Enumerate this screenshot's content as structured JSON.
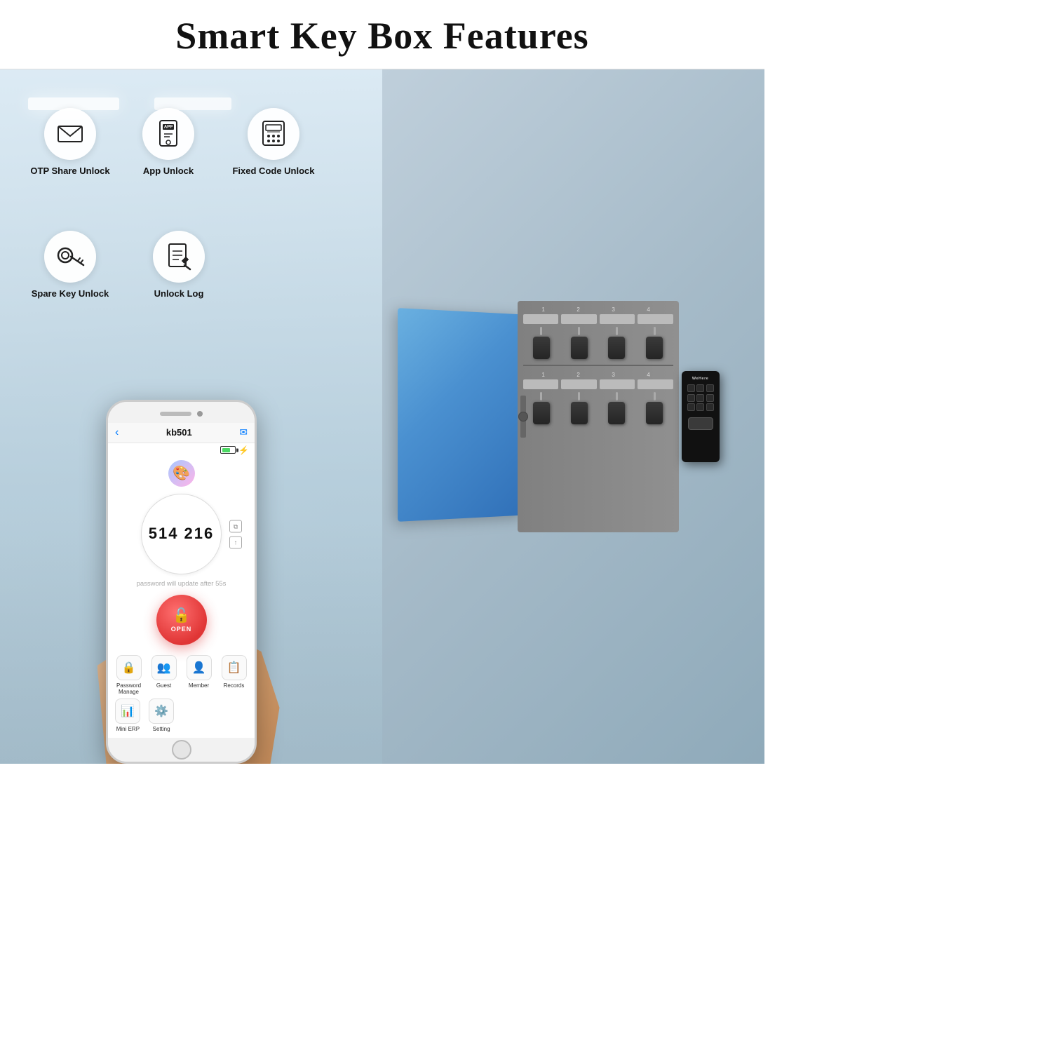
{
  "header": {
    "title": "Smart Key Box Features"
  },
  "features": {
    "top_row": [
      {
        "id": "otp-share-unlock",
        "label": "OTP Share Unlock",
        "icon": "envelope"
      },
      {
        "id": "app-unlock",
        "label": "App Unlock",
        "icon": "app"
      },
      {
        "id": "fixed-code-unlock",
        "label": "Fixed Code Unlock",
        "icon": "keypad"
      }
    ],
    "bottom_row": [
      {
        "id": "spare-key-unlock",
        "label": "Spare Key Unlock",
        "icon": "key"
      },
      {
        "id": "unlock-log",
        "label": "Unlock Log",
        "icon": "log"
      }
    ]
  },
  "phone": {
    "device_name": "kb501",
    "otp_code": "514 216",
    "timer_text": "password will update after 55s",
    "open_label": "OPEN",
    "menu_items": [
      {
        "label": "Password\nManage",
        "icon": "🔒"
      },
      {
        "label": "Guest",
        "icon": "👥"
      },
      {
        "label": "Member",
        "icon": "👤"
      },
      {
        "label": "Records",
        "icon": "📋"
      }
    ],
    "menu_items_row2": [
      {
        "label": "Mini ERP",
        "icon": "📊"
      },
      {
        "label": "Setting",
        "icon": "⚙️"
      }
    ]
  },
  "keybox": {
    "brand": "WeHere",
    "color": "#3a7ab8"
  }
}
